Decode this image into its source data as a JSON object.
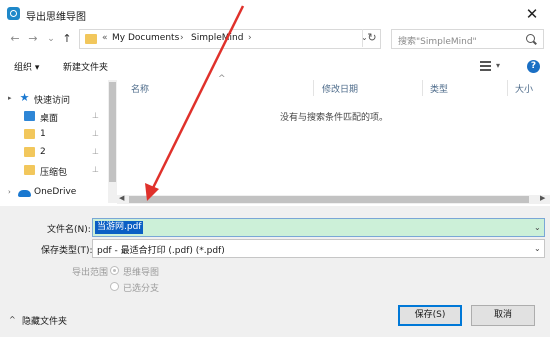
{
  "window": {
    "title": "导出思维导图",
    "close_glyph": "✕"
  },
  "nav": {
    "back": "←",
    "forward": "→",
    "recent": "⌄",
    "up": "↑",
    "breadcrumb": {
      "chevron": "«",
      "items": [
        "My Documents",
        "SimpleMind"
      ],
      "sep": "›"
    },
    "address_drop": "⌄",
    "refresh": "↻",
    "search_placeholder": "搜索\"SimpleMind\""
  },
  "toolbar": {
    "organize": "组织 ▾",
    "new_folder": "新建文件夹",
    "view_drop": "▾",
    "help": "?"
  },
  "sidebar": {
    "items": [
      {
        "label": "快速访问",
        "icon": "star-icon",
        "pinned": false
      },
      {
        "label": "桌面",
        "icon": "desktop-icon",
        "pinned": true
      },
      {
        "label": "1",
        "icon": "folder-icon",
        "pinned": true
      },
      {
        "label": "2",
        "icon": "folder-icon",
        "pinned": true
      },
      {
        "label": "压缩包",
        "icon": "folder-icon",
        "pinned": true
      },
      {
        "label": "OneDrive",
        "icon": "cloud-icon",
        "pinned": false
      }
    ],
    "pin_glyph": "📌"
  },
  "filelist": {
    "columns": [
      "名称",
      "修改日期",
      "类型",
      "大小"
    ],
    "sort_arrow": "^",
    "empty_message": "没有与搜索条件匹配的项。",
    "scroll_left": "◀",
    "scroll_right": "▶"
  },
  "form": {
    "filename_label": "文件名(N):",
    "filename_value": "当游网.pdf",
    "filetype_label": "保存类型(T):",
    "filetype_value": "pdf - 最适合打印 (.pdf) (*.pdf)",
    "export_range_label": "导出范围",
    "range_options": [
      "思维导图",
      "已选分支"
    ],
    "dropdown": "⌄"
  },
  "footer": {
    "hide_folders": "隐藏文件夹",
    "hide_chevron": "^",
    "save": "保存(S)",
    "cancel": "取消"
  },
  "colors": {
    "accent": "#0078d7",
    "arrow": "#e0312b",
    "filename_bg": "#ccf0d8",
    "selection": "#0a5fc4"
  }
}
